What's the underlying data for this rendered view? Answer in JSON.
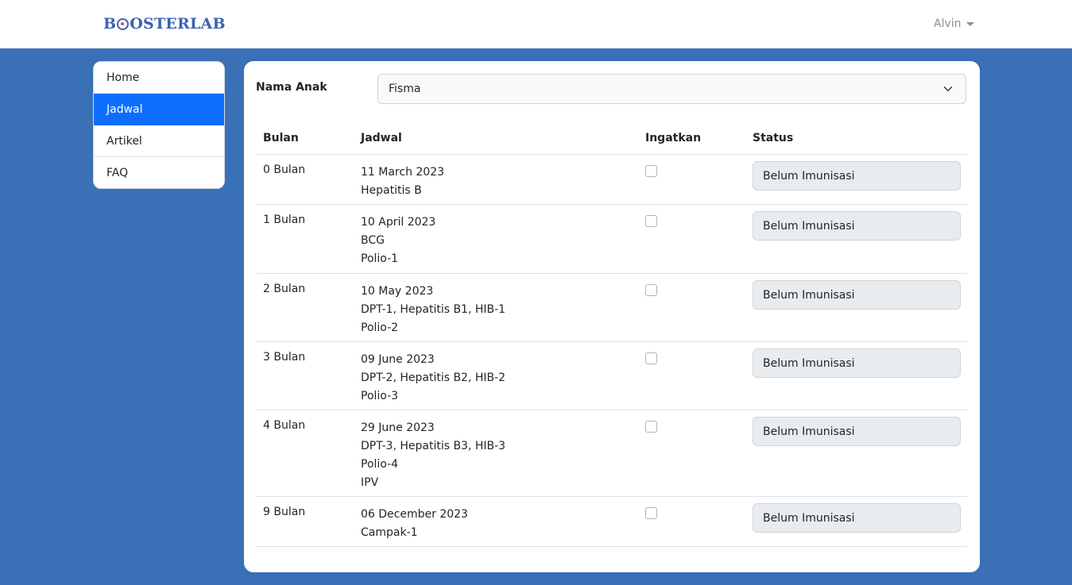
{
  "navbar": {
    "brand_prefix": "B",
    "brand_suffix": "OSTERLAB",
    "user_name": "Alvin"
  },
  "sidebar": {
    "items": [
      {
        "label": "Home"
      },
      {
        "label": "Jadwal"
      },
      {
        "label": "Artikel"
      },
      {
        "label": "FAQ"
      }
    ]
  },
  "form": {
    "label": "Nama Anak",
    "selected": "Fisma"
  },
  "table": {
    "headers": [
      "Bulan",
      "Jadwal",
      "Ingatkan",
      "Status"
    ],
    "rows": [
      {
        "bulan": "0 Bulan",
        "date": "11 March 2023",
        "vaccines": [
          "Hepatitis B"
        ],
        "status": "Belum Imunisasi"
      },
      {
        "bulan": "1 Bulan",
        "date": "10 April 2023",
        "vaccines": [
          "BCG",
          "Polio-1"
        ],
        "status": "Belum Imunisasi"
      },
      {
        "bulan": "2 Bulan",
        "date": "10 May 2023",
        "vaccines": [
          "DPT-1, Hepatitis B1, HIB-1",
          "Polio-2"
        ],
        "status": "Belum Imunisasi"
      },
      {
        "bulan": "3 Bulan",
        "date": "09 June 2023",
        "vaccines": [
          "DPT-2, Hepatitis B2, HIB-2",
          "Polio-3"
        ],
        "status": "Belum Imunisasi"
      },
      {
        "bulan": "4 Bulan",
        "date": "29 June 2023",
        "vaccines": [
          "DPT-3, Hepatitis B3, HIB-3",
          "Polio-4",
          "IPV"
        ],
        "status": "Belum Imunisasi"
      },
      {
        "bulan": "9 Bulan",
        "date": "06 December 2023",
        "vaccines": [
          "Campak-1"
        ],
        "status": "Belum Imunisasi"
      }
    ]
  }
}
